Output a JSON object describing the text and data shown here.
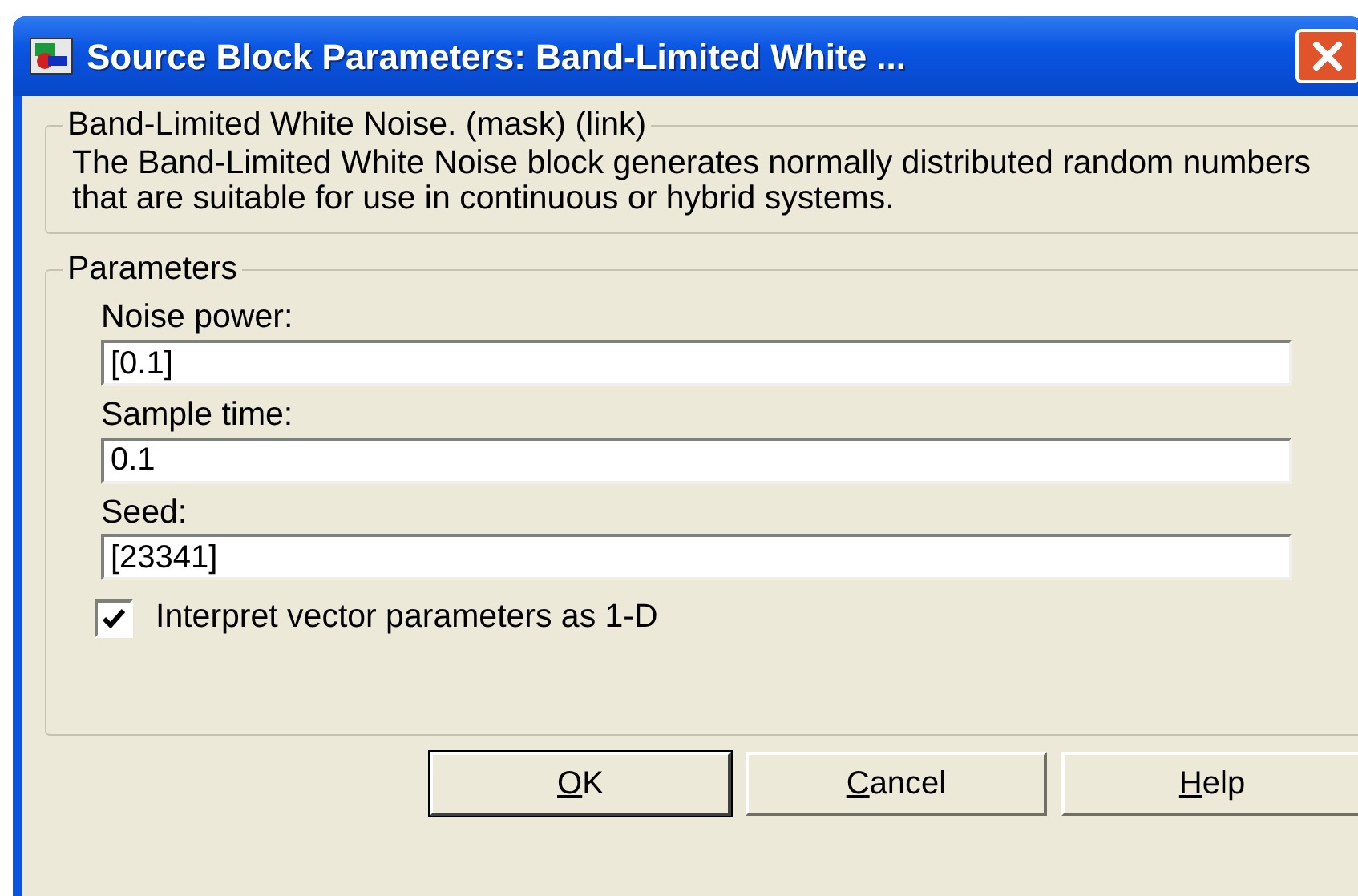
{
  "window": {
    "title": "Source Block Parameters: Band-Limited White ..."
  },
  "description_group": {
    "legend": "Band-Limited White Noise. (mask) (link)",
    "text": "The Band-Limited White Noise block generates normally distributed random numbers that are suitable for use in continuous or hybrid systems."
  },
  "parameters_group": {
    "legend": "Parameters",
    "fields": [
      {
        "label": "Noise power:",
        "value": "[0.1]"
      },
      {
        "label": "Sample time:",
        "value": "0.1"
      },
      {
        "label": "Seed:",
        "value": "[23341]"
      }
    ],
    "checkbox": {
      "label": "Interpret vector parameters as 1-D",
      "checked": true
    }
  },
  "buttons": [
    {
      "mnemonic": "O",
      "rest": "K",
      "default": true
    },
    {
      "mnemonic": "C",
      "rest": "ancel",
      "default": false
    },
    {
      "mnemonic": "H",
      "rest": "elp",
      "default": false
    }
  ]
}
